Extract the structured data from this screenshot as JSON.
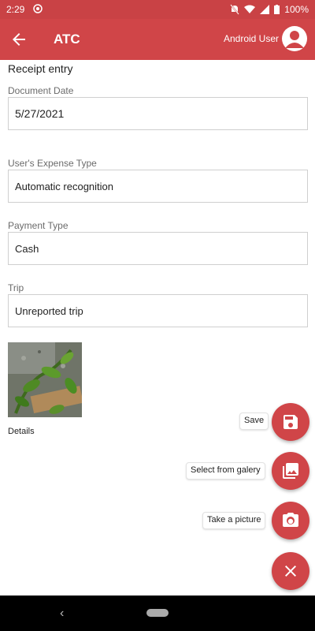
{
  "status_bar": {
    "time": "2:29",
    "battery": "100%"
  },
  "app_bar": {
    "title": "ATC",
    "user_name": "Android User"
  },
  "form": {
    "section_title": "Receipt entry",
    "fields": [
      {
        "label": "Document Date",
        "value": "5/27/2021"
      },
      {
        "label": "User's Expense Type",
        "value": "Automatic recognition"
      },
      {
        "label": "Payment Type",
        "value": "Cash"
      },
      {
        "label": "Trip",
        "value": "Unreported trip"
      }
    ],
    "details_label": "Details"
  },
  "fab_menu": {
    "save_label": "Save",
    "gallery_label": "Select from galery",
    "camera_label": "Take a picture"
  },
  "colors": {
    "primary": "#d04548",
    "status_bar": "#c94245"
  },
  "icons": [
    "back-arrow-icon",
    "avatar-icon",
    "save-icon",
    "gallery-icon",
    "camera-icon",
    "close-icon"
  ]
}
